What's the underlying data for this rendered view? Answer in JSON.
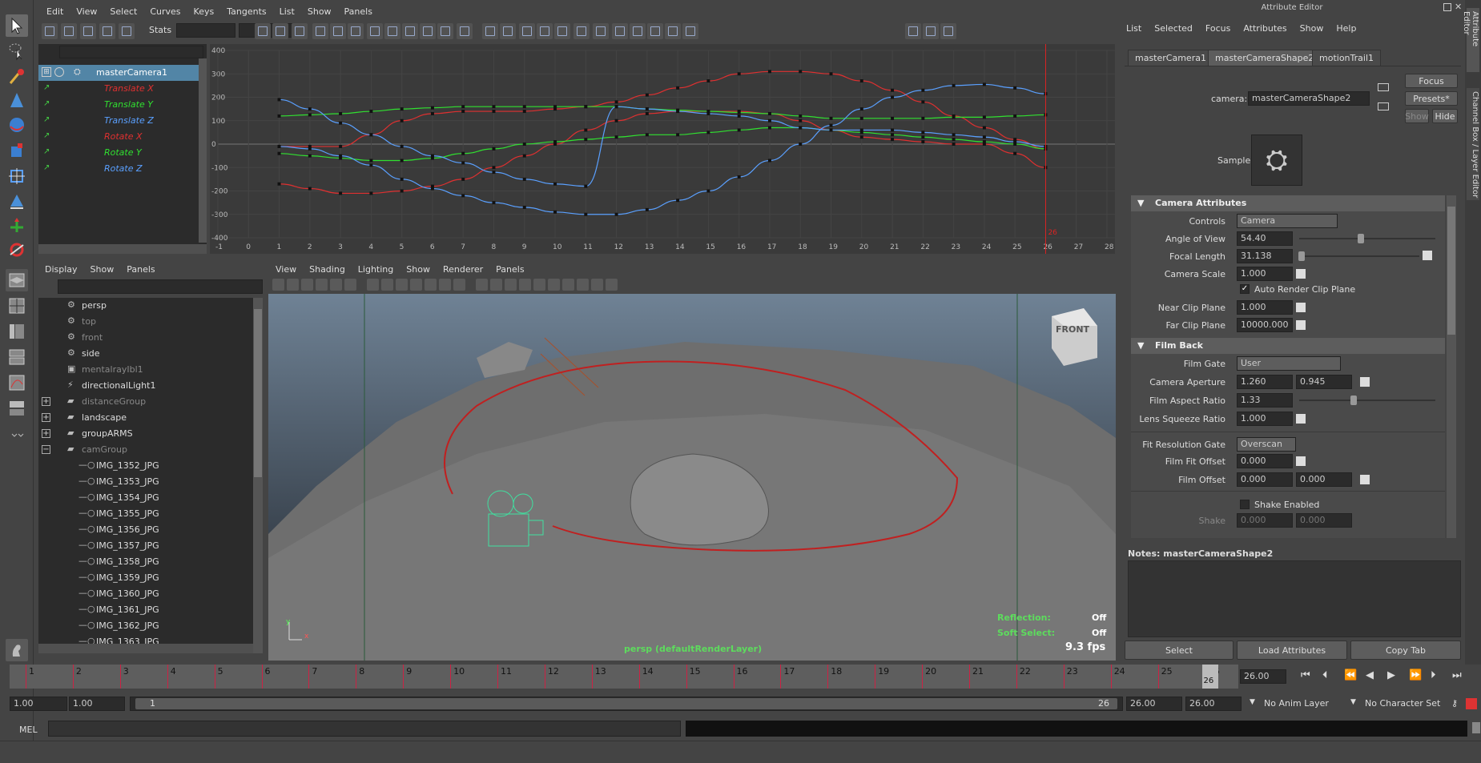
{
  "menus": {
    "graph": [
      "Edit",
      "View",
      "Select",
      "Curves",
      "Keys",
      "Tangents",
      "List",
      "Show",
      "Panels"
    ],
    "outliner": [
      "Display",
      "Show",
      "Panels"
    ],
    "viewport": [
      "View",
      "Shading",
      "Lighting",
      "Show",
      "Renderer",
      "Panels"
    ],
    "attr": [
      "List",
      "Selected",
      "Focus",
      "Attributes",
      "Show",
      "Help"
    ]
  },
  "graph_toolbar": {
    "stats_label": "Stats"
  },
  "graph_outliner": {
    "root": "masterCamera1",
    "channels": [
      {
        "label": "Translate X",
        "color": "#e03030"
      },
      {
        "label": "Translate Y",
        "color": "#30e030"
      },
      {
        "label": "Translate Z",
        "color": "#5aa0ff"
      },
      {
        "label": "Rotate X",
        "color": "#e03030"
      },
      {
        "label": "Rotate Y",
        "color": "#30e030"
      },
      {
        "label": "Rotate Z",
        "color": "#5aa0ff"
      }
    ]
  },
  "chart_data": {
    "type": "line",
    "x": [
      1,
      2,
      3,
      4,
      5,
      6,
      7,
      8,
      9,
      10,
      11,
      12,
      13,
      14,
      15,
      16,
      17,
      18,
      19,
      20,
      21,
      22,
      23,
      24,
      25,
      26
    ],
    "xlim": [
      -1,
      28
    ],
    "ylim": [
      -400,
      400
    ],
    "xticks": [
      "-1",
      "0",
      "1",
      "2",
      "3",
      "4",
      "5",
      "6",
      "7",
      "8",
      "9",
      "10",
      "11",
      "12",
      "13",
      "14",
      "15",
      "16",
      "17",
      "18",
      "19",
      "20",
      "21",
      "22",
      "23",
      "24",
      "25",
      "26",
      "27",
      "28"
    ],
    "yticks": [
      "400",
      "300",
      "200",
      "100",
      "0",
      "-100",
      "-200",
      "-300",
      "-400"
    ],
    "current_frame": "26",
    "series": [
      {
        "color": "#e03030",
        "values": [
          -170,
          -190,
          -210,
          -210,
          -200,
          -180,
          -150,
          -100,
          -50,
          0,
          60,
          100,
          130,
          140,
          140,
          140,
          130,
          100,
          60,
          30,
          20,
          10,
          0,
          0,
          -40,
          -100
        ]
      },
      {
        "color": "#e03030",
        "values": [
          -10,
          -10,
          -10,
          40,
          100,
          130,
          140,
          140,
          140,
          150,
          160,
          180,
          210,
          240,
          270,
          300,
          310,
          310,
          300,
          270,
          230,
          180,
          120,
          70,
          20,
          -20
        ]
      },
      {
        "color": "#30e030",
        "values": [
          -40,
          -50,
          -60,
          -70,
          -70,
          -60,
          -40,
          -20,
          0,
          10,
          20,
          30,
          40,
          40,
          50,
          60,
          70,
          70,
          60,
          50,
          40,
          30,
          20,
          10,
          0,
          -20
        ]
      },
      {
        "color": "#30e030",
        "values": [
          120,
          125,
          130,
          140,
          150,
          155,
          160,
          160,
          160,
          160,
          160,
          160,
          150,
          145,
          140,
          135,
          130,
          120,
          110,
          110,
          110,
          110,
          115,
          115,
          120,
          125
        ]
      },
      {
        "color": "#5aa0ff",
        "values": [
          190,
          150,
          90,
          40,
          -10,
          -50,
          -80,
          -120,
          -150,
          -170,
          -180,
          160,
          150,
          140,
          130,
          120,
          100,
          70,
          60,
          60,
          60,
          50,
          40,
          30,
          10,
          -10
        ]
      },
      {
        "color": "#5aa0ff",
        "values": [
          -10,
          -20,
          -50,
          -90,
          -150,
          -190,
          -220,
          -250,
          -270,
          -290,
          -300,
          -300,
          -280,
          -240,
          -200,
          -140,
          -70,
          0,
          80,
          150,
          200,
          230,
          250,
          255,
          240,
          215
        ]
      }
    ]
  },
  "outliner": {
    "items": [
      {
        "label": "persp",
        "dim": false,
        "icon": "camera-icon"
      },
      {
        "label": "top",
        "dim": true,
        "icon": "camera-icon"
      },
      {
        "label": "front",
        "dim": true,
        "icon": "camera-icon"
      },
      {
        "label": "side",
        "dim": false,
        "icon": "camera-icon"
      },
      {
        "label": "mentalrayIbl1",
        "dim": true,
        "icon": "ibl-icon"
      },
      {
        "label": "directionalLight1",
        "dim": false,
        "icon": "light-icon"
      },
      {
        "label": "distanceGroup",
        "dim": true,
        "icon": "group-icon"
      },
      {
        "label": "landscape",
        "dim": false,
        "icon": "group-icon"
      },
      {
        "label": "groupARMS",
        "dim": false,
        "icon": "group-icon"
      },
      {
        "label": "camGroup",
        "dim": true,
        "icon": "group-icon"
      },
      {
        "label": "IMG_1352_JPG",
        "dim": false,
        "icon": "locator-icon"
      },
      {
        "label": "IMG_1353_JPG",
        "dim": false,
        "icon": "locator-icon"
      },
      {
        "label": "IMG_1354_JPG",
        "dim": false,
        "icon": "locator-icon"
      },
      {
        "label": "IMG_1355_JPG",
        "dim": false,
        "icon": "locator-icon"
      },
      {
        "label": "IMG_1356_JPG",
        "dim": false,
        "icon": "locator-icon"
      },
      {
        "label": "IMG_1357_JPG",
        "dim": false,
        "icon": "locator-icon"
      },
      {
        "label": "IMG_1358_JPG",
        "dim": false,
        "icon": "locator-icon"
      },
      {
        "label": "IMG_1359_JPG",
        "dim": false,
        "icon": "locator-icon"
      },
      {
        "label": "IMG_1360_JPG",
        "dim": false,
        "icon": "locator-icon"
      },
      {
        "label": "IMG_1361_JPG",
        "dim": false,
        "icon": "locator-icon"
      },
      {
        "label": "IMG_1362_JPG",
        "dim": false,
        "icon": "locator-icon"
      },
      {
        "label": "IMG_1363_JPG",
        "dim": false,
        "icon": "locator-icon"
      }
    ]
  },
  "viewport": {
    "view_cube": "FRONT",
    "camera_label": "persp (defaultRenderLayer)",
    "reflection_label": "Reflection:",
    "reflection_value": "Off",
    "soft_select_label": "Soft Select:",
    "soft_select_value": "Off",
    "fps": "9.3 fps",
    "axis_x": "x",
    "axis_y": "y"
  },
  "attr": {
    "title": "Attribute Editor",
    "tabs": [
      "masterCamera1",
      "masterCameraShape2",
      "motionTrail1"
    ],
    "camera_label": "camera:",
    "camera_value": "masterCameraShape2",
    "focus_btn": "Focus",
    "presets_btn": "Presets*",
    "show_btn": "Show",
    "hide_btn": "Hide",
    "sample_label": "Sample",
    "camera_attributes": "Camera Attributes",
    "controls_label": "Controls",
    "controls_value": "Camera",
    "angle_label": "Angle of View",
    "angle_value": "54.40",
    "angle_fraction": 0.45,
    "focal_label": "Focal Length",
    "focal_value": "31.138",
    "focal_fraction": 0.02,
    "scale_label": "Camera Scale",
    "scale_value": "1.000",
    "auto_clip_label": "Auto Render Clip Plane",
    "auto_clip_checked": true,
    "near_label": "Near Clip Plane",
    "near_value": "1.000",
    "far_label": "Far Clip Plane",
    "far_value": "10000.000",
    "film_back": "Film Back",
    "film_gate_label": "Film Gate",
    "film_gate_value": "User",
    "aperture_label": "Camera Aperture",
    "aperture_x": "1.260",
    "aperture_y": "0.945",
    "aspect_label": "Film Aspect Ratio",
    "aspect_value": "1.33",
    "aspect_fraction": 0.4,
    "squeeze_label": "Lens Squeeze Ratio",
    "squeeze_value": "1.000",
    "fit_gate_label": "Fit Resolution Gate",
    "fit_gate_value": "Overscan",
    "fit_offset_label": "Film Fit Offset",
    "fit_offset_value": "0.000",
    "film_offset_label": "Film Offset",
    "film_offset_x": "0.000",
    "film_offset_y": "0.000",
    "shake_enabled_label": "Shake Enabled",
    "shake_label": "Shake",
    "shake_x": "0.000",
    "shake_y": "0.000",
    "notes_label": "Notes:  masterCameraShape2",
    "select_btn": "Select",
    "load_btn": "Load Attributes",
    "copy_btn": "Copy Tab",
    "side_tab_attr": "Attribute Editor",
    "side_tab_channel": "Channel Box / Layer Editor"
  },
  "timeline": {
    "frames": [
      "1",
      "2",
      "3",
      "4",
      "5",
      "6",
      "7",
      "8",
      "9",
      "10",
      "11",
      "12",
      "13",
      "14",
      "15",
      "16",
      "17",
      "18",
      "19",
      "20",
      "21",
      "22",
      "23",
      "24",
      "25",
      "26"
    ],
    "current_frame": "26",
    "current_time": "26.00",
    "start": "1.00",
    "start2": "1.00",
    "range_start": "1",
    "range_end": "26",
    "end": "26.00",
    "end2": "26.00",
    "anim_layer": "No Anim Layer",
    "char_set": "No Character Set"
  },
  "command": {
    "label": "MEL"
  }
}
